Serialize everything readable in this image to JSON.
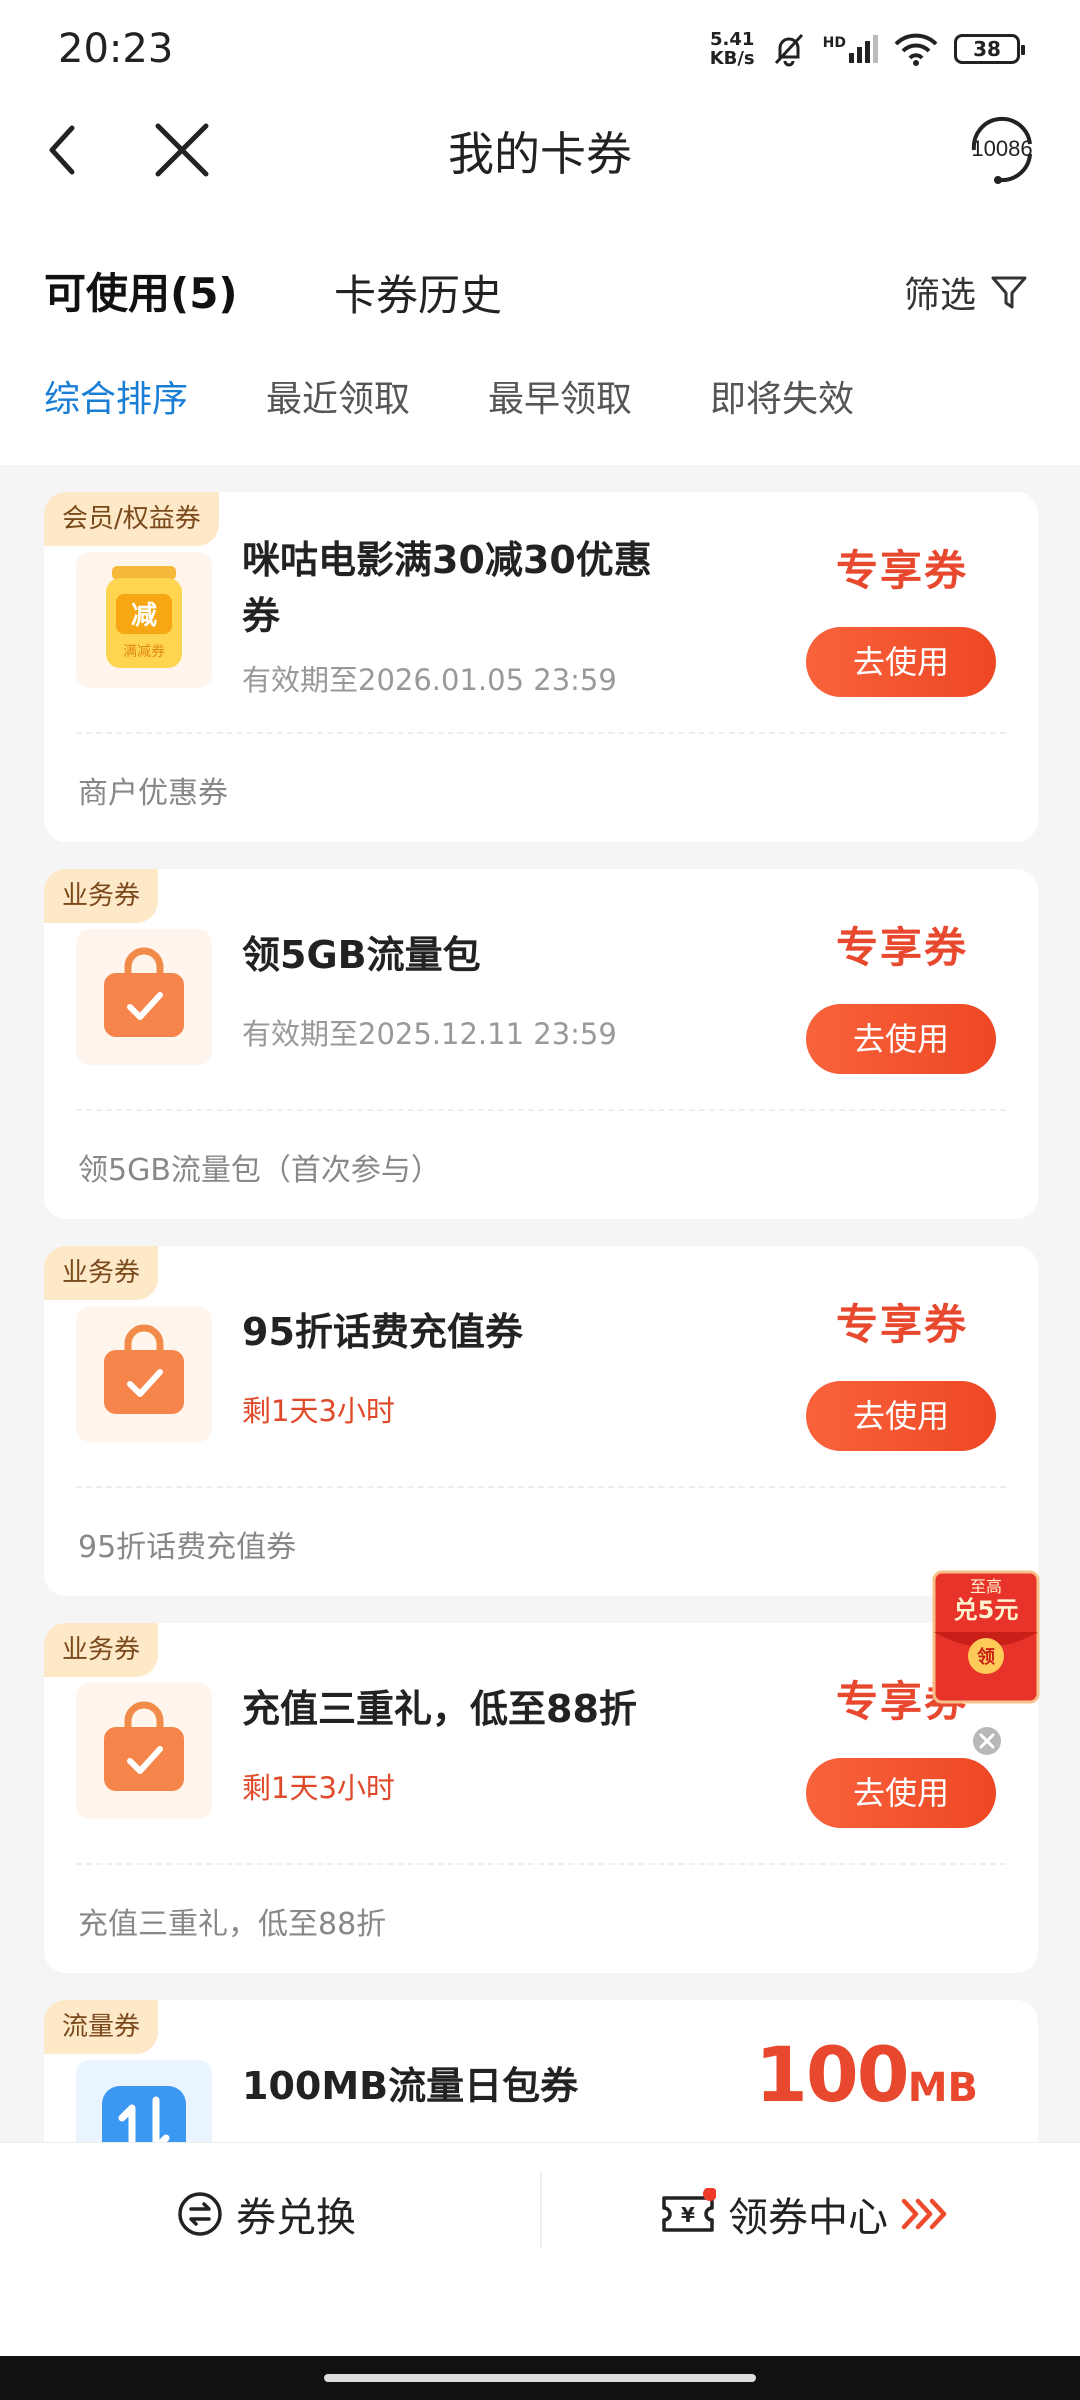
{
  "status_bar": {
    "time": "20:23",
    "net_speed_value": "5.41",
    "net_speed_unit": "KB/s",
    "signal_label": "HD",
    "battery": "38"
  },
  "header": {
    "title": "我的卡券",
    "service_number": "10086"
  },
  "tabs": {
    "available": "可使用(5)",
    "history": "卡券历史",
    "filter": "筛选"
  },
  "sort_options": [
    "综合排序",
    "最近领取",
    "最早领取",
    "即将失效"
  ],
  "coupons": [
    {
      "tag": "会员/权益券",
      "title": "咪咕电影满30减30优惠券",
      "subtitle": "有效期至2026.01.05 23:59",
      "label": "专享券",
      "button": "去使用",
      "description": "商户优惠券",
      "icon_char": "减",
      "icon_caption": "满减券"
    },
    {
      "tag": "业务券",
      "title": "领5GB流量包",
      "subtitle": "有效期至2025.12.11 23:59",
      "label": "专享券",
      "button": "去使用",
      "description": "领5GB流量包（首次参与）"
    },
    {
      "tag": "业务券",
      "title": "95折话费充值券",
      "subtitle": "剩1天3小时",
      "label": "专享券",
      "button": "去使用",
      "description": "95折话费充值券"
    },
    {
      "tag": "业务券",
      "title": "充值三重礼，低至88折",
      "subtitle": "剩1天3小时",
      "label": "专享券",
      "button": "去使用",
      "description": "充值三重礼，低至88折"
    },
    {
      "tag": "流量券",
      "title": "100MB流量日包券",
      "amount": "100",
      "unit": "MB"
    }
  ],
  "red_packet": {
    "line1": "至高",
    "line2": "兑5元",
    "coin": "领"
  },
  "bottom_bar": {
    "exchange": "券兑换",
    "center": "领券中心"
  },
  "colors": {
    "accent_blue": "#1a7fd4",
    "accent_red": "#e8482e",
    "button_orange": "#f25a33"
  }
}
